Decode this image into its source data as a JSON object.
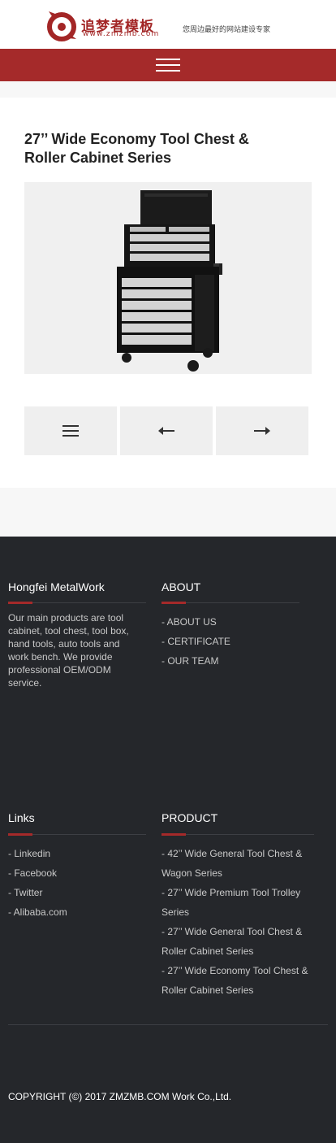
{
  "header": {
    "logo_title": "追梦者模板",
    "logo_url": "www.zmzmb.com",
    "slogan": "您周边最好的网站建设专家",
    "brand_color": "#a52a2a"
  },
  "nav": {
    "menu_icon": "hamburger-menu-icon"
  },
  "product": {
    "title": "27’’ Wide Economy Tool Chest & Roller Cabinet Series",
    "image_subject": "tool-chest-roller-cabinet"
  },
  "gallery_controls": {
    "menu_icon": "list-icon",
    "prev_icon": "arrow-left-icon",
    "next_icon": "arrow-right-icon"
  },
  "footer": {
    "company": {
      "title": "Hongfei MetalWork",
      "text": "Our main products are tool cabinet, tool chest, tool box, hand tools, auto tools and work bench. We provide professional OEM/ODM service."
    },
    "about": {
      "title": "ABOUT",
      "links": [
        "- ABOUT US",
        "- CERTIFICATE",
        "- OUR TEAM"
      ]
    },
    "links": {
      "title": "Links",
      "links": [
        "- Linkedin",
        "- Facebook",
        "- Twitter",
        "- Alibaba.com"
      ]
    },
    "product": {
      "title": "PRODUCT",
      "links": [
        "- 42’’ Wide General Tool Chest & Wagon Series",
        "- 27’’ Wide Premium Tool Trolley Series",
        "- 27’’ Wide General Tool Chest & Roller Cabinet Series",
        "- 27’’ Wide Economy Tool Chest & Roller Cabinet Series"
      ]
    },
    "copyright": "COPYRIGHT (©) 2017 ZMZMB.COM Work Co.,Ltd."
  }
}
